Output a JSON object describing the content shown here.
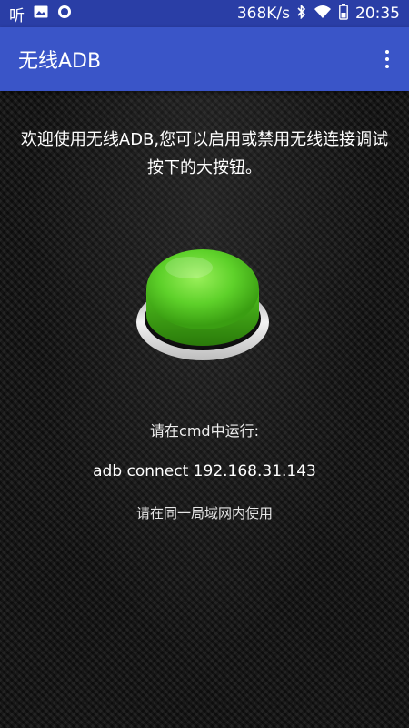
{
  "status_bar": {
    "left_label": "听",
    "speed": "368K/s",
    "time": "20:35",
    "icons": [
      "image-icon",
      "record-icon",
      "bluetooth-icon",
      "wifi-icon",
      "battery-icon"
    ]
  },
  "app_bar": {
    "title": "无线ADB",
    "menu_icon": "more-vert-icon",
    "color": "#3a55c8"
  },
  "main": {
    "welcome_text": "欢迎使用无线ADB,您可以启用或禁用无线连接调试按下的大按钮。",
    "button_state_color": "#5ed12a",
    "cmd_hint": "请在cmd中运行:",
    "adb_command": "adb connect 192.168.31.143",
    "lan_hint": "请在同一局域网内使用"
  }
}
